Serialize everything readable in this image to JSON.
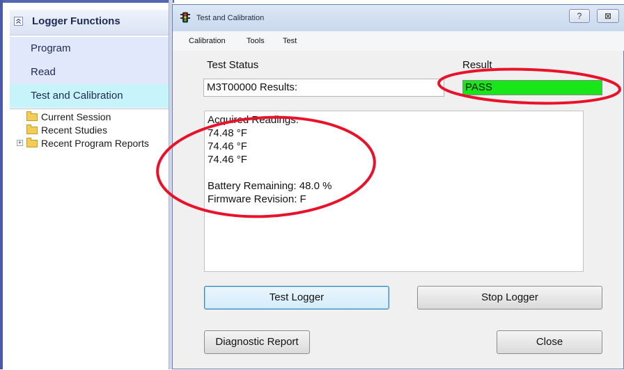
{
  "left_panel": {
    "title": "Logger Functions",
    "nav": [
      {
        "label": "Program"
      },
      {
        "label": "Read"
      },
      {
        "label": "Test and Calibration",
        "active": true
      }
    ],
    "tree": [
      {
        "label": "Current Session"
      },
      {
        "label": "Recent Studies"
      },
      {
        "label": "Recent Program Reports",
        "expandable": true
      }
    ]
  },
  "dialog": {
    "title": "Test and Calibration",
    "help_button": "?",
    "close_button": "⊠",
    "menu": [
      "Calibration",
      "Tools",
      "Test"
    ],
    "test_status_label": "Test Status",
    "result_label": "Result",
    "status_value": "M3T00000 Results:",
    "result_value": "PASS",
    "result_color": "#19e619",
    "readings_lines": [
      "Acquired Readings:",
      "74.48 °F",
      "74.46 °F",
      "74.46 °F",
      "",
      "Battery Remaining: 48.0 %",
      "Firmware Revision: F"
    ],
    "buttons": {
      "test_logger": "Test Logger",
      "stop_logger": "Stop Logger",
      "diagnostic_report": "Diagnostic Report",
      "close": "Close"
    }
  },
  "annotation_color": "#e8132a"
}
